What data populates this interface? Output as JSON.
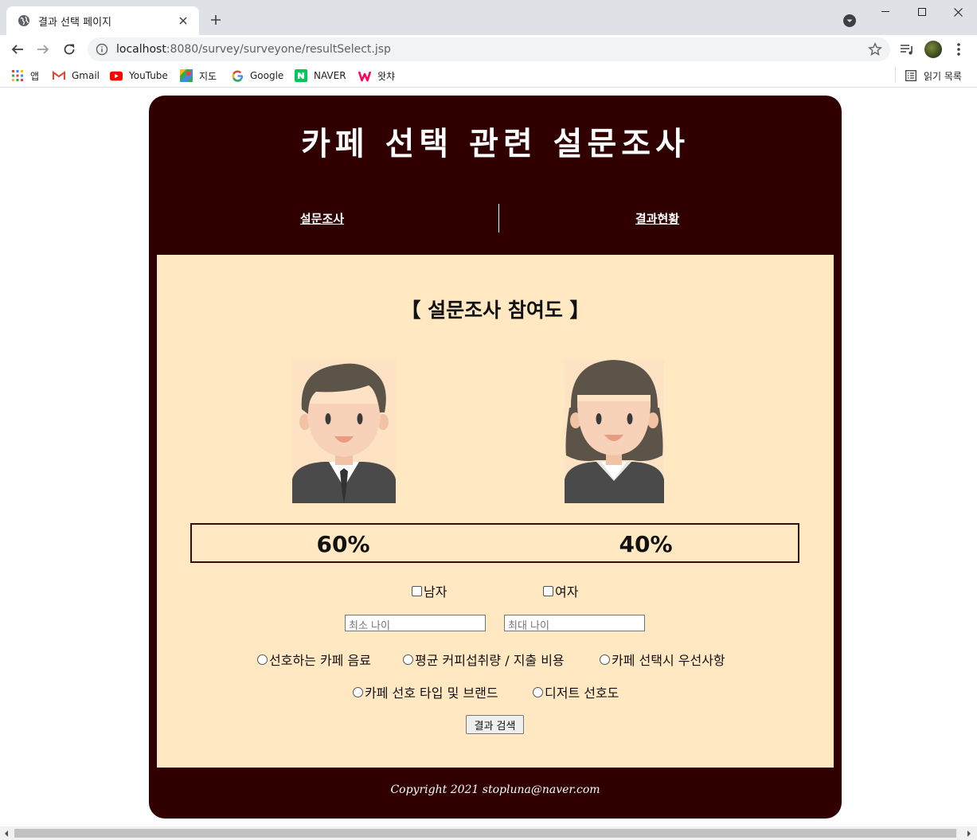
{
  "browser": {
    "tab_title": "결과 선택 페이지",
    "url_host": "localhost",
    "url_path": ":8080/survey/surveyone/resultSelect.jsp",
    "bookmarks": [
      "앱",
      "Gmail",
      "YouTube",
      "지도",
      "Google",
      "NAVER",
      "왓챠"
    ],
    "reading_list": "읽기 목록"
  },
  "site": {
    "title": "카페 선택 관련 설문조사",
    "nav": [
      "설문조사",
      "결과현황"
    ],
    "copyright": "Copyright 2021 stopluna@naver.com"
  },
  "participation": {
    "section_title": "【 설문조사 참여도 】",
    "male_percent": "60%",
    "female_percent": "40%"
  },
  "form": {
    "gender_options": [
      "남자",
      "여자"
    ],
    "min_age_placeholder": "최소 나이",
    "max_age_placeholder": "최대 나이",
    "categories_row1": [
      "선호하는 카페 음료",
      "평균 커피섭취량 / 지출 비용",
      "카페 선택시 우선사항"
    ],
    "categories_row2": [
      "카페 선호 타입 및 브랜드",
      "디저트 선호도"
    ],
    "submit_label": "결과 검색"
  },
  "colors": {
    "frame": "#300000",
    "content_bg": "#ffe8c2",
    "pct_border": "#3a0b0b"
  }
}
